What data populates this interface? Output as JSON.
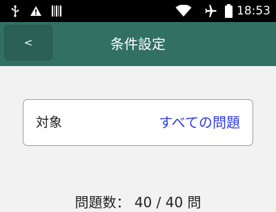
{
  "status_bar": {
    "time": "18:53",
    "icons": [
      "usb-icon",
      "warning-icon",
      "barcode-icon",
      "wifi-icon",
      "airplane-mode-icon",
      "battery-icon"
    ]
  },
  "app_bar": {
    "back_label": "<",
    "title": "条件設定"
  },
  "target": {
    "label": "対象",
    "value": "すべての問題"
  },
  "question_count": {
    "label": "問題数：",
    "value": "40 / 40 問"
  }
}
